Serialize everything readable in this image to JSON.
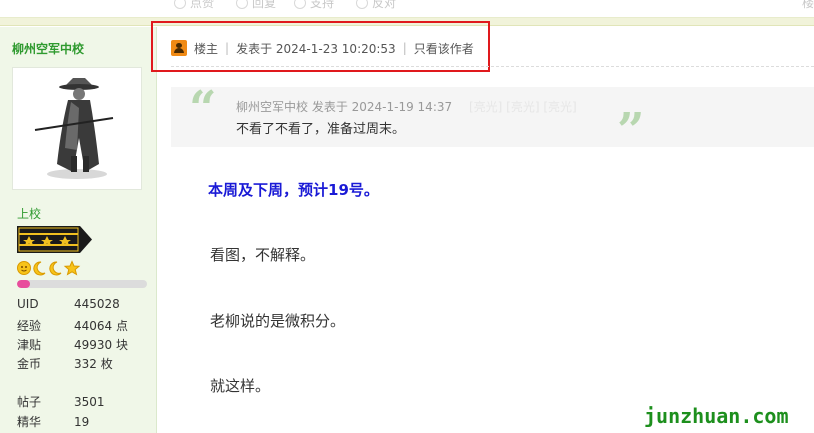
{
  "toolbar": {
    "items": [
      "点赞",
      "回复",
      "支持",
      "反对"
    ],
    "right": "楼"
  },
  "profile": {
    "username": "柳州空军中校",
    "rank": "上校",
    "level_progress": 0.1,
    "medal_icons": [
      "sun-face-icon",
      "moon-icon",
      "moon-icon",
      "star-icon"
    ],
    "stats": [
      {
        "label": "UID",
        "value": "445028"
      },
      {
        "label": "经验",
        "value": "44064 点"
      },
      {
        "label": "津贴",
        "value": "49930 块"
      },
      {
        "label": "金币",
        "value": "332 枚"
      },
      {
        "label": "帖子",
        "value": "3501"
      },
      {
        "label": "精华",
        "value": "19"
      }
    ]
  },
  "post_header": {
    "role": "楼主",
    "posted": "发表于 2024-1-23 10:20:53",
    "only_author": "只看该作者"
  },
  "quote": {
    "author_time": "柳州空军中校 发表于 2024-1-19 14:37",
    "faint_text": "[亮光] [亮光] [亮光]",
    "text": "不看了不看了，准备过周末。"
  },
  "body": {
    "headline": "本周及下周，预计19号。",
    "paragraphs": [
      "看图，不解释。",
      "老柳说的是微积分。",
      "就这样。"
    ]
  },
  "watermark": "junzhuan.com",
  "colors": {
    "accent_green": "#2f9a2f",
    "highlight_red": "#e0191d",
    "headline_blue": "#1a1ad6",
    "progress_pink": "#e84d9c"
  }
}
